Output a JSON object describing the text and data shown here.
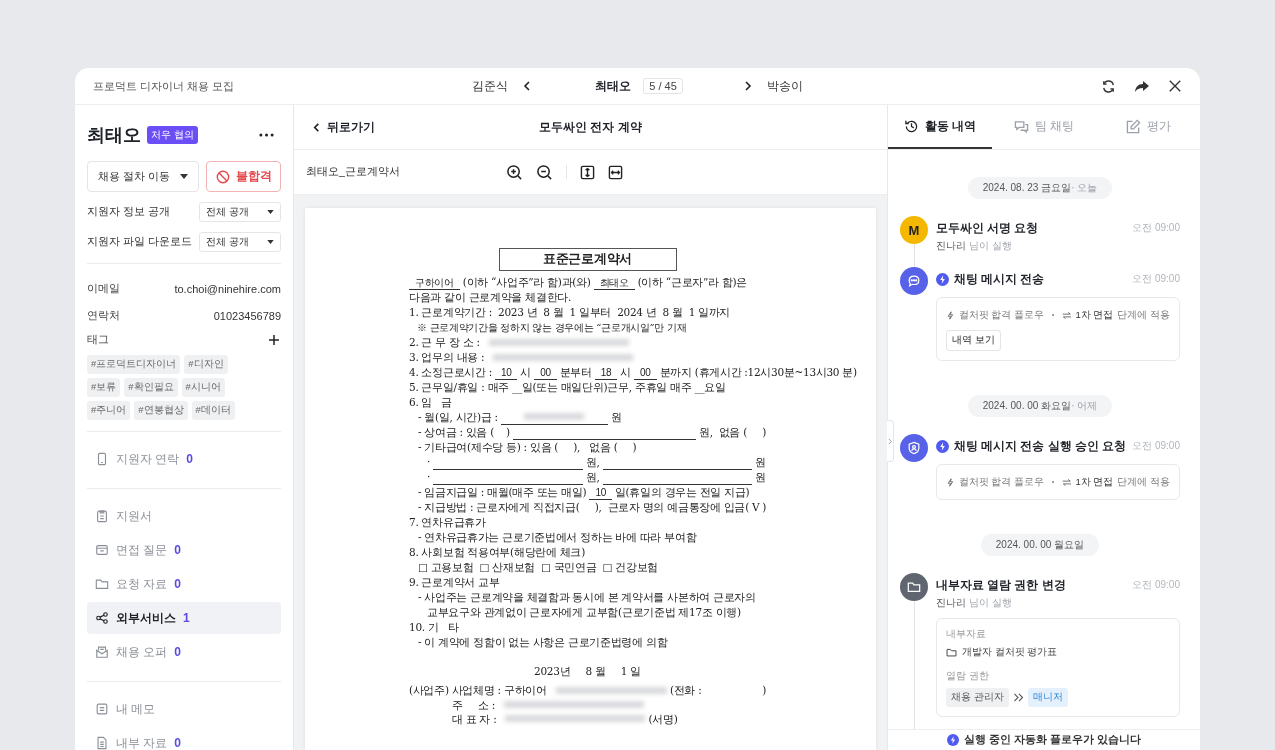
{
  "window": {
    "title": "프로덕트 디자이너 채용 모집"
  },
  "navigator": {
    "previous": "김준식",
    "current": "최태오",
    "position": "5 / 45",
    "next": "박송이"
  },
  "candidate": {
    "name": "최태오",
    "badge": "처우 협의",
    "stage_select": "채용 절차 이동",
    "reject_button": "불합격",
    "settings": [
      {
        "label": "지원자 정보 공개",
        "value": "전체 공개"
      },
      {
        "label": "지원자 파일 다운로드",
        "value": "전체 공개"
      }
    ],
    "info": [
      {
        "label": "이메일",
        "value": "to.choi@ninehire.com"
      },
      {
        "label": "연락처",
        "value": "01023456789"
      }
    ],
    "tags_label": "태그",
    "tags": [
      "#프로덕트디자이너",
      "#디자인",
      "#보류",
      "#확인필요",
      "#시니어",
      "#주니어",
      "#연봉협상",
      "#데이터"
    ]
  },
  "nav_groups": [
    [
      {
        "kind": "phone",
        "label": "지원자 연락",
        "count": "0",
        "selected": false
      }
    ],
    [
      {
        "kind": "clipboard",
        "label": "지원서",
        "selected": false
      },
      {
        "kind": "tray",
        "label": "면접 질문",
        "count": "0",
        "selected": false
      },
      {
        "kind": "folder",
        "label": "요청 자료",
        "count": "0",
        "selected": false
      },
      {
        "kind": "share",
        "label": "외부서비스",
        "count": "1",
        "selected": true
      },
      {
        "kind": "mail",
        "label": "채용 오퍼",
        "count": "0",
        "selected": false
      }
    ],
    [
      {
        "kind": "memo",
        "label": "내 메모",
        "selected": false
      },
      {
        "kind": "doc",
        "label": "내부 자료",
        "count": "0",
        "selected": false
      }
    ]
  ],
  "viewer": {
    "back": "뒤로가기",
    "title": "모두싸인 전자 계약",
    "file_name": "최태오_근로계약서",
    "document": {
      "title": "표준근로계약서",
      "lines": [
        {
          "kind": "text",
          "segs": [
            {
              "kind": "fill",
              "text": "구하이어"
            },
            {
              "kind": "text",
              "text": "(이하 “사업주”라 함)과(와)"
            },
            {
              "kind": "fill",
              "text": "최태오"
            },
            {
              "kind": "text",
              "text": "(이하 “근로자”라 함)은"
            }
          ]
        },
        {
          "kind": "text",
          "segs": [
            {
              "kind": "text",
              "text": "다음과 같이 근로계약을 체결한다."
            }
          ]
        },
        {
          "kind": "text",
          "segs": [
            {
              "kind": "text",
              "text": "1. 근로계약기간 :  2023 년  8 월  1 일부터  2024 년  8 월  1 일까지"
            }
          ]
        },
        {
          "kind": "note",
          "segs": [
            {
              "kind": "text",
              "text": "※ 근로계약기간을 정하지 않는 경우에는 “근로개시일”만 기재"
            }
          ]
        },
        {
          "kind": "text",
          "segs": [
            {
              "kind": "text",
              "text": "2. 근 무 장 소 :"
            },
            {
              "kind": "redacted"
            }
          ]
        },
        {
          "kind": "text",
          "segs": [
            {
              "kind": "text",
              "text": "3. 업무의 내용 :"
            },
            {
              "kind": "redacted"
            }
          ]
        },
        {
          "kind": "text",
          "segs": [
            {
              "kind": "text",
              "text": "4. 소정근로시간 :"
            },
            {
              "kind": "fill",
              "text": "10"
            },
            {
              "kind": "text",
              "text": "시"
            },
            {
              "kind": "fill",
              "text": "00"
            },
            {
              "kind": "text",
              "text": "분부터"
            },
            {
              "kind": "fill",
              "text": "18"
            },
            {
              "kind": "text",
              "text": "시"
            },
            {
              "kind": "fill",
              "text": "00"
            },
            {
              "kind": "text",
              "text": "분까지 (휴게시간 :12시30분~13시30 분)"
            }
          ]
        },
        {
          "kind": "text",
          "segs": [
            {
              "kind": "text",
              "text": "5. 근무일/휴일 : 매주 __일(또는 매일단위)근무, 주휴일 매주 __요일"
            }
          ]
        },
        {
          "kind": "text",
          "segs": [
            {
              "kind": "text",
              "text": "6. 임   금"
            }
          ]
        },
        {
          "kind": "sub",
          "segs": [
            {
              "kind": "text",
              "text": "- 월(일, 시간)급 :"
            },
            {
              "kind": "fill_redacted"
            },
            {
              "kind": "text",
              "text": "원"
            }
          ]
        },
        {
          "kind": "sub",
          "segs": [
            {
              "kind": "text",
              "text": "- 상여금 : 있음 (    )"
            },
            {
              "kind": "fill"
            },
            {
              "kind": "text",
              "text": "원,  없음 (     )"
            }
          ]
        },
        {
          "kind": "sub",
          "segs": [
            {
              "kind": "text",
              "text": "- 기타급여(제수당 등) : 있음 (     ),   없음 (     )"
            }
          ]
        },
        {
          "kind": "subsub",
          "segs": [
            {
              "kind": "text",
              "text": "·"
            },
            {
              "kind": "fill"
            },
            {
              "kind": "text",
              "text": "원,"
            },
            {
              "kind": "fill"
            },
            {
              "kind": "text",
              "text": "원"
            }
          ]
        },
        {
          "kind": "subsub",
          "segs": [
            {
              "kind": "text",
              "text": "·"
            },
            {
              "kind": "fill"
            },
            {
              "kind": "text",
              "text": "원,"
            },
            {
              "kind": "fill"
            },
            {
              "kind": "text",
              "text": "원"
            }
          ]
        },
        {
          "kind": "sub",
          "segs": [
            {
              "kind": "text",
              "text": "- 임금지급일 : 매월(매주 또는 매일)"
            },
            {
              "kind": "fill",
              "text": "10"
            },
            {
              "kind": "text",
              "text": "일(휴일의 경우는 전일 지급)"
            }
          ]
        },
        {
          "kind": "sub",
          "segs": [
            {
              "kind": "text",
              "text": "- 지급방법 : 근로자에게 직접지급(     ),  근로자 명의 예금통장에 입금( V )"
            }
          ]
        },
        {
          "kind": "text",
          "segs": [
            {
              "kind": "text",
              "text": "7. 연차유급휴가"
            }
          ]
        },
        {
          "kind": "sub",
          "segs": [
            {
              "kind": "text",
              "text": "- 연차유급휴가는 근로기준법에서 정하는 바에 따라 부여함"
            }
          ]
        },
        {
          "kind": "text",
          "segs": [
            {
              "kind": "text",
              "text": "8. 사회보험 적용여부(해당란에 체크)"
            }
          ]
        },
        {
          "kind": "sub",
          "segs": [
            {
              "kind": "text",
              "text": "□ 고용보험  □ 산재보험  □ 국민연금  □ 건강보험"
            }
          ]
        },
        {
          "kind": "text",
          "segs": [
            {
              "kind": "text",
              "text": "9. 근로계약서 교부"
            }
          ]
        },
        {
          "kind": "sub",
          "segs": [
            {
              "kind": "text",
              "text": "- 사업주는 근로계약을 체결함과 동시에 본 계약서를 사본하여 근로자의"
            }
          ]
        },
        {
          "kind": "subsub",
          "segs": [
            {
              "kind": "text",
              "text": "교부요구와 관계없이 근로자에게 교부함(근로기준법 제17조 이행)"
            }
          ]
        },
        {
          "kind": "text",
          "segs": [
            {
              "kind": "text",
              "text": "10. 기   타"
            }
          ]
        },
        {
          "kind": "sub",
          "segs": [
            {
              "kind": "text",
              "text": "- 이 계약에 정함이 없는 사항은 근로기준법령에 의함"
            }
          ]
        },
        {
          "kind": "center",
          "segs": [
            {
              "kind": "text",
              "text": "2023년     8 월     1 일"
            }
          ]
        },
        {
          "kind": "text",
          "segs": [
            {
              "kind": "text",
              "text": "(사업주) 사업체명 :"
            },
            {
              "kind": "text",
              "text": "구하이어"
            },
            {
              "kind": "redacted"
            },
            {
              "kind": "text",
              "text": "(전화 :                    )"
            }
          ]
        },
        {
          "kind": "sign",
          "segs": [
            {
              "kind": "text",
              "text": "주     소 :"
            },
            {
              "kind": "redacted"
            }
          ]
        },
        {
          "kind": "sign",
          "segs": [
            {
              "kind": "text",
              "text": "대 표 자 :"
            },
            {
              "kind": "redacted"
            },
            {
              "kind": "text",
              "text": "(서명)"
            }
          ]
        }
      ]
    }
  },
  "activity": {
    "tabs": [
      {
        "kind": "history",
        "label": "활동 내역",
        "selected": true
      },
      {
        "kind": "chat",
        "label": "팀 채팅",
        "selected": false
      },
      {
        "kind": "edit",
        "label": "평가",
        "selected": false
      }
    ],
    "groups": [
      {
        "date": "2024. 08. 23 금요일",
        "note": "· 오늘",
        "events": [
          {
            "kind": "letter",
            "letter": "M",
            "automated": false,
            "title": "모두싸인 서명 요청",
            "time": "오전 09:00",
            "actor": "진나리",
            "actor_suffix": "님이 실행"
          },
          {
            "kind": "chat",
            "automated": true,
            "title": "채팅 메시지 전송",
            "time": "오전 09:00",
            "card": {
              "kind": "flow",
              "flow": "컬처핏 합격 플로우",
              "stage": "1차 면접",
              "stage_suffix": "단계에 적용",
              "button": "내역 보기"
            }
          }
        ]
      },
      {
        "date": "2024. 00. 00 화요일",
        "note": "· 어제",
        "events": [
          {
            "kind": "shield",
            "automated": true,
            "title": "채팅 메시지 전송 실행 승인 요청",
            "time": "오전 09:00",
            "card": {
              "kind": "flow",
              "flow": "컬처핏 합격 플로우",
              "stage": "1차 면접",
              "stage_suffix": "단계에 적용"
            }
          }
        ]
      },
      {
        "date": "2024. 00. 00 월요일",
        "events": [
          {
            "kind": "folder",
            "automated": false,
            "title": "내부자료 열람 권한 변경",
            "time": "오전 09:00",
            "actor": "진나리",
            "actor_suffix": "님이 실행",
            "card": {
              "kind": "permission",
              "section": "내부자료",
              "file": "개발자 컬처핏 평가표",
              "access_label": "열람 권한",
              "from": "채용 관리자",
              "to": "매니저"
            }
          }
        ]
      }
    ],
    "footer": "실행 중인 자동화 플로우가 있습니다"
  }
}
